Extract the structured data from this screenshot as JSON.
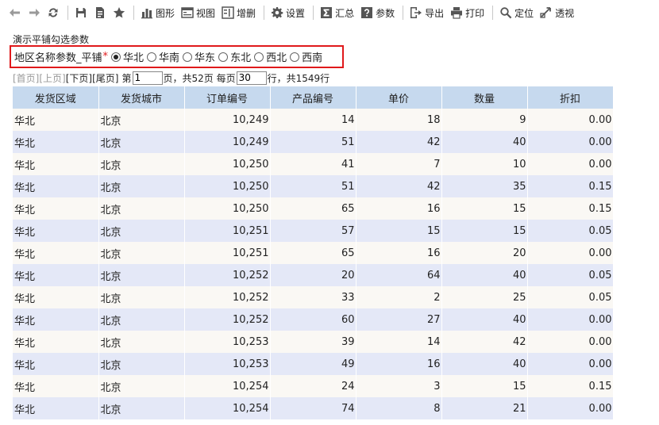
{
  "toolbar": {
    "items": [
      {
        "name": "back-button",
        "icon": "arrow-left-icon",
        "label": ""
      },
      {
        "name": "forward-button",
        "icon": "arrow-right-icon",
        "label": ""
      },
      {
        "name": "refresh-button",
        "icon": "refresh-icon",
        "label": ""
      },
      {
        "name": "save-button",
        "icon": "save-icon",
        "label": ""
      },
      {
        "name": "save-as-button",
        "icon": "save-as-icon",
        "label": ""
      },
      {
        "name": "favorite-button",
        "icon": "star-icon",
        "label": ""
      },
      {
        "name": "chart-button",
        "icon": "bar-chart-icon",
        "label": "图形"
      },
      {
        "name": "view-button",
        "icon": "view-icon",
        "label": "视图"
      },
      {
        "name": "add-delete-button",
        "icon": "edit-rows-icon",
        "label": "增删"
      },
      {
        "name": "settings-button",
        "icon": "gear-icon",
        "label": "设置"
      },
      {
        "name": "summary-button",
        "icon": "sigma-icon",
        "label": "汇总"
      },
      {
        "name": "parameters-button",
        "icon": "question-icon",
        "label": "参数"
      },
      {
        "name": "export-button",
        "icon": "export-icon",
        "label": "导出"
      },
      {
        "name": "print-button",
        "icon": "printer-icon",
        "label": "打印"
      },
      {
        "name": "locate-button",
        "icon": "magnifier-icon",
        "label": "定位"
      },
      {
        "name": "pivot-button",
        "icon": "pivot-icon",
        "label": "透视"
      }
    ]
  },
  "report": {
    "title": "演示平铺勾选参数"
  },
  "param": {
    "label": "地区名称参数_平铺",
    "required_mark": "*",
    "options": [
      "华北",
      "华南",
      "华东",
      "东北",
      "西北",
      "西南"
    ],
    "selected": "华北"
  },
  "pager": {
    "first": "[首页]",
    "prev": "[上页]",
    "next": "[下页]",
    "last": "[尾页]",
    "page_prefix": "第",
    "page_value": "1",
    "page_suffix": "页，共52页 每页",
    "per_page_value": "30",
    "rows_suffix": "行，共1549行"
  },
  "table": {
    "columns": [
      "发货区域",
      "发货城市",
      "订单编号",
      "产品编号",
      "单价",
      "数量",
      "折扣"
    ],
    "rows": [
      [
        "华北",
        "北京",
        "10,249",
        "14",
        "18",
        "9",
        "0.00"
      ],
      [
        "华北",
        "北京",
        "10,249",
        "51",
        "42",
        "40",
        "0.00"
      ],
      [
        "华北",
        "北京",
        "10,250",
        "41",
        "7",
        "10",
        "0.00"
      ],
      [
        "华北",
        "北京",
        "10,250",
        "51",
        "42",
        "35",
        "0.15"
      ],
      [
        "华北",
        "北京",
        "10,250",
        "65",
        "16",
        "15",
        "0.15"
      ],
      [
        "华北",
        "北京",
        "10,251",
        "57",
        "15",
        "15",
        "0.05"
      ],
      [
        "华北",
        "北京",
        "10,251",
        "65",
        "16",
        "20",
        "0.00"
      ],
      [
        "华北",
        "北京",
        "10,252",
        "20",
        "64",
        "40",
        "0.05"
      ],
      [
        "华北",
        "北京",
        "10,252",
        "33",
        "2",
        "25",
        "0.05"
      ],
      [
        "华北",
        "北京",
        "10,252",
        "60",
        "27",
        "40",
        "0.00"
      ],
      [
        "华北",
        "北京",
        "10,253",
        "39",
        "14",
        "42",
        "0.00"
      ],
      [
        "华北",
        "北京",
        "10,253",
        "49",
        "16",
        "40",
        "0.00"
      ],
      [
        "华北",
        "北京",
        "10,254",
        "24",
        "3",
        "15",
        "0.15"
      ],
      [
        "华北",
        "北京",
        "10,254",
        "74",
        "8",
        "21",
        "0.00"
      ]
    ]
  }
}
